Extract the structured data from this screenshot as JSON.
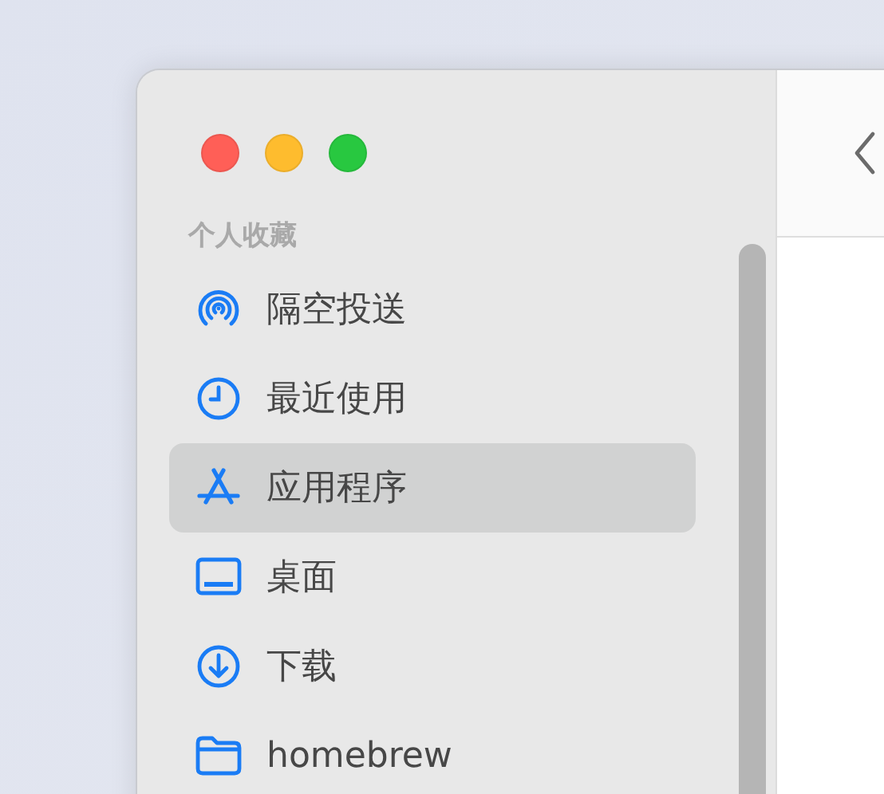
{
  "window": {
    "traffic_lights": [
      {
        "color": "#ff5f57"
      },
      {
        "color": "#febc2e"
      },
      {
        "color": "#28c840"
      }
    ]
  },
  "sidebar": {
    "section_title": "个人收藏",
    "items": [
      {
        "kind": "airdrop",
        "label": "隔空投送",
        "selected": false
      },
      {
        "kind": "recents",
        "label": "最近使用",
        "selected": false
      },
      {
        "kind": "applications",
        "label": "应用程序",
        "selected": true
      },
      {
        "kind": "desktop",
        "label": "桌面",
        "selected": false
      },
      {
        "kind": "downloads",
        "label": "下载",
        "selected": false
      },
      {
        "kind": "folder",
        "label": "homebrew",
        "selected": false
      }
    ]
  }
}
